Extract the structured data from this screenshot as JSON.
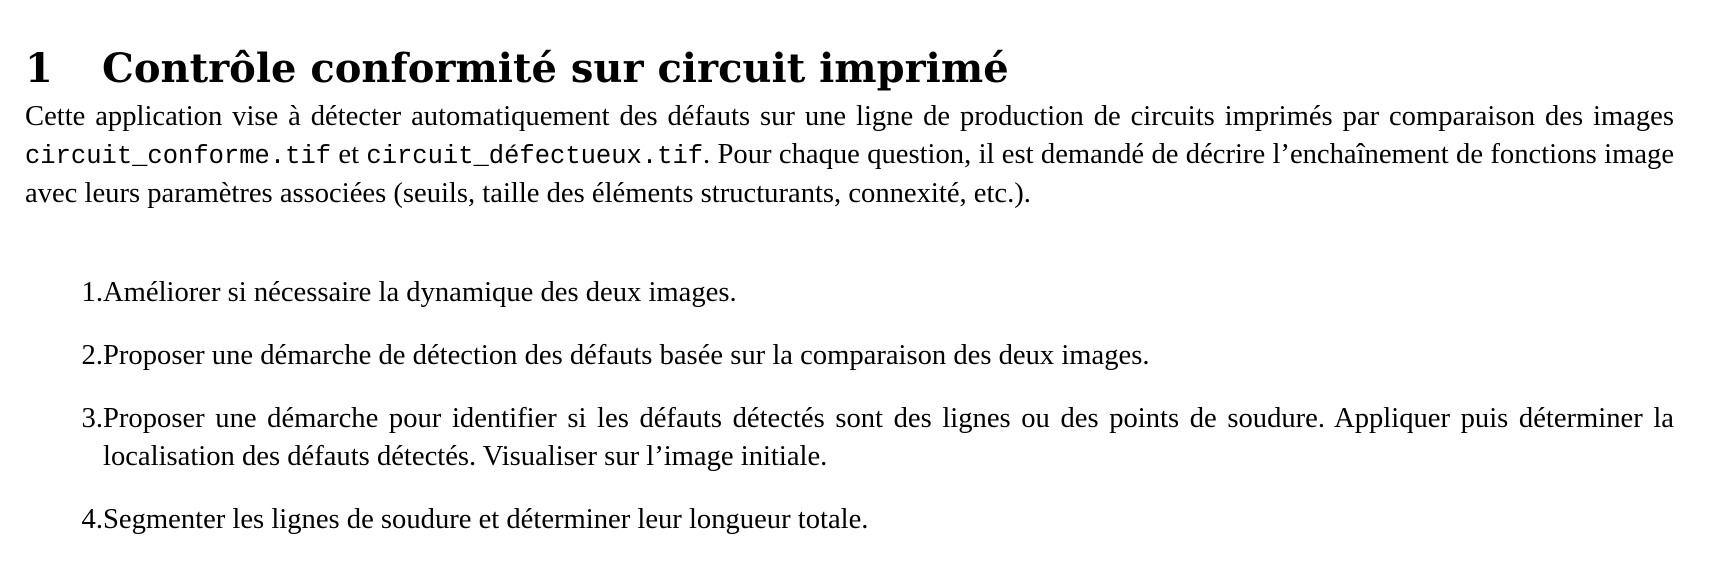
{
  "section": {
    "number": "1",
    "title": "Contrôle conformité sur circuit imprimé"
  },
  "intro": {
    "text_before": "Cette application vise à détecter automatiquement des défauts sur une ligne de production de circuits imprimés par comparaison des images ",
    "file_conforme": "circuit_conforme.tif",
    "text_between": " et ",
    "file_defectueux": "circuit_défectueux.tif",
    "text_after": ". Pour chaque question, il est demandé de décrire l’enchaînement de fonctions image avec leurs paramètres associées (seuils, taille des éléments structurants, connexité, etc.)."
  },
  "tasks": [
    {
      "number": "1.",
      "text": "Améliorer si nécessaire la dynamique des deux images."
    },
    {
      "number": "2.",
      "text": "Proposer une démarche de détection des défauts basée sur la comparaison des deux images."
    },
    {
      "number": "3.",
      "text": "Proposer une démarche pour identifier si les défauts détectés sont des lignes ou des points de soudure. Appliquer puis déterminer la localisation des défauts détectés. Visualiser sur l’image initiale."
    },
    {
      "number": "4.",
      "text": "Segmenter les lignes de soudure et déterminer leur longueur totale."
    }
  ]
}
